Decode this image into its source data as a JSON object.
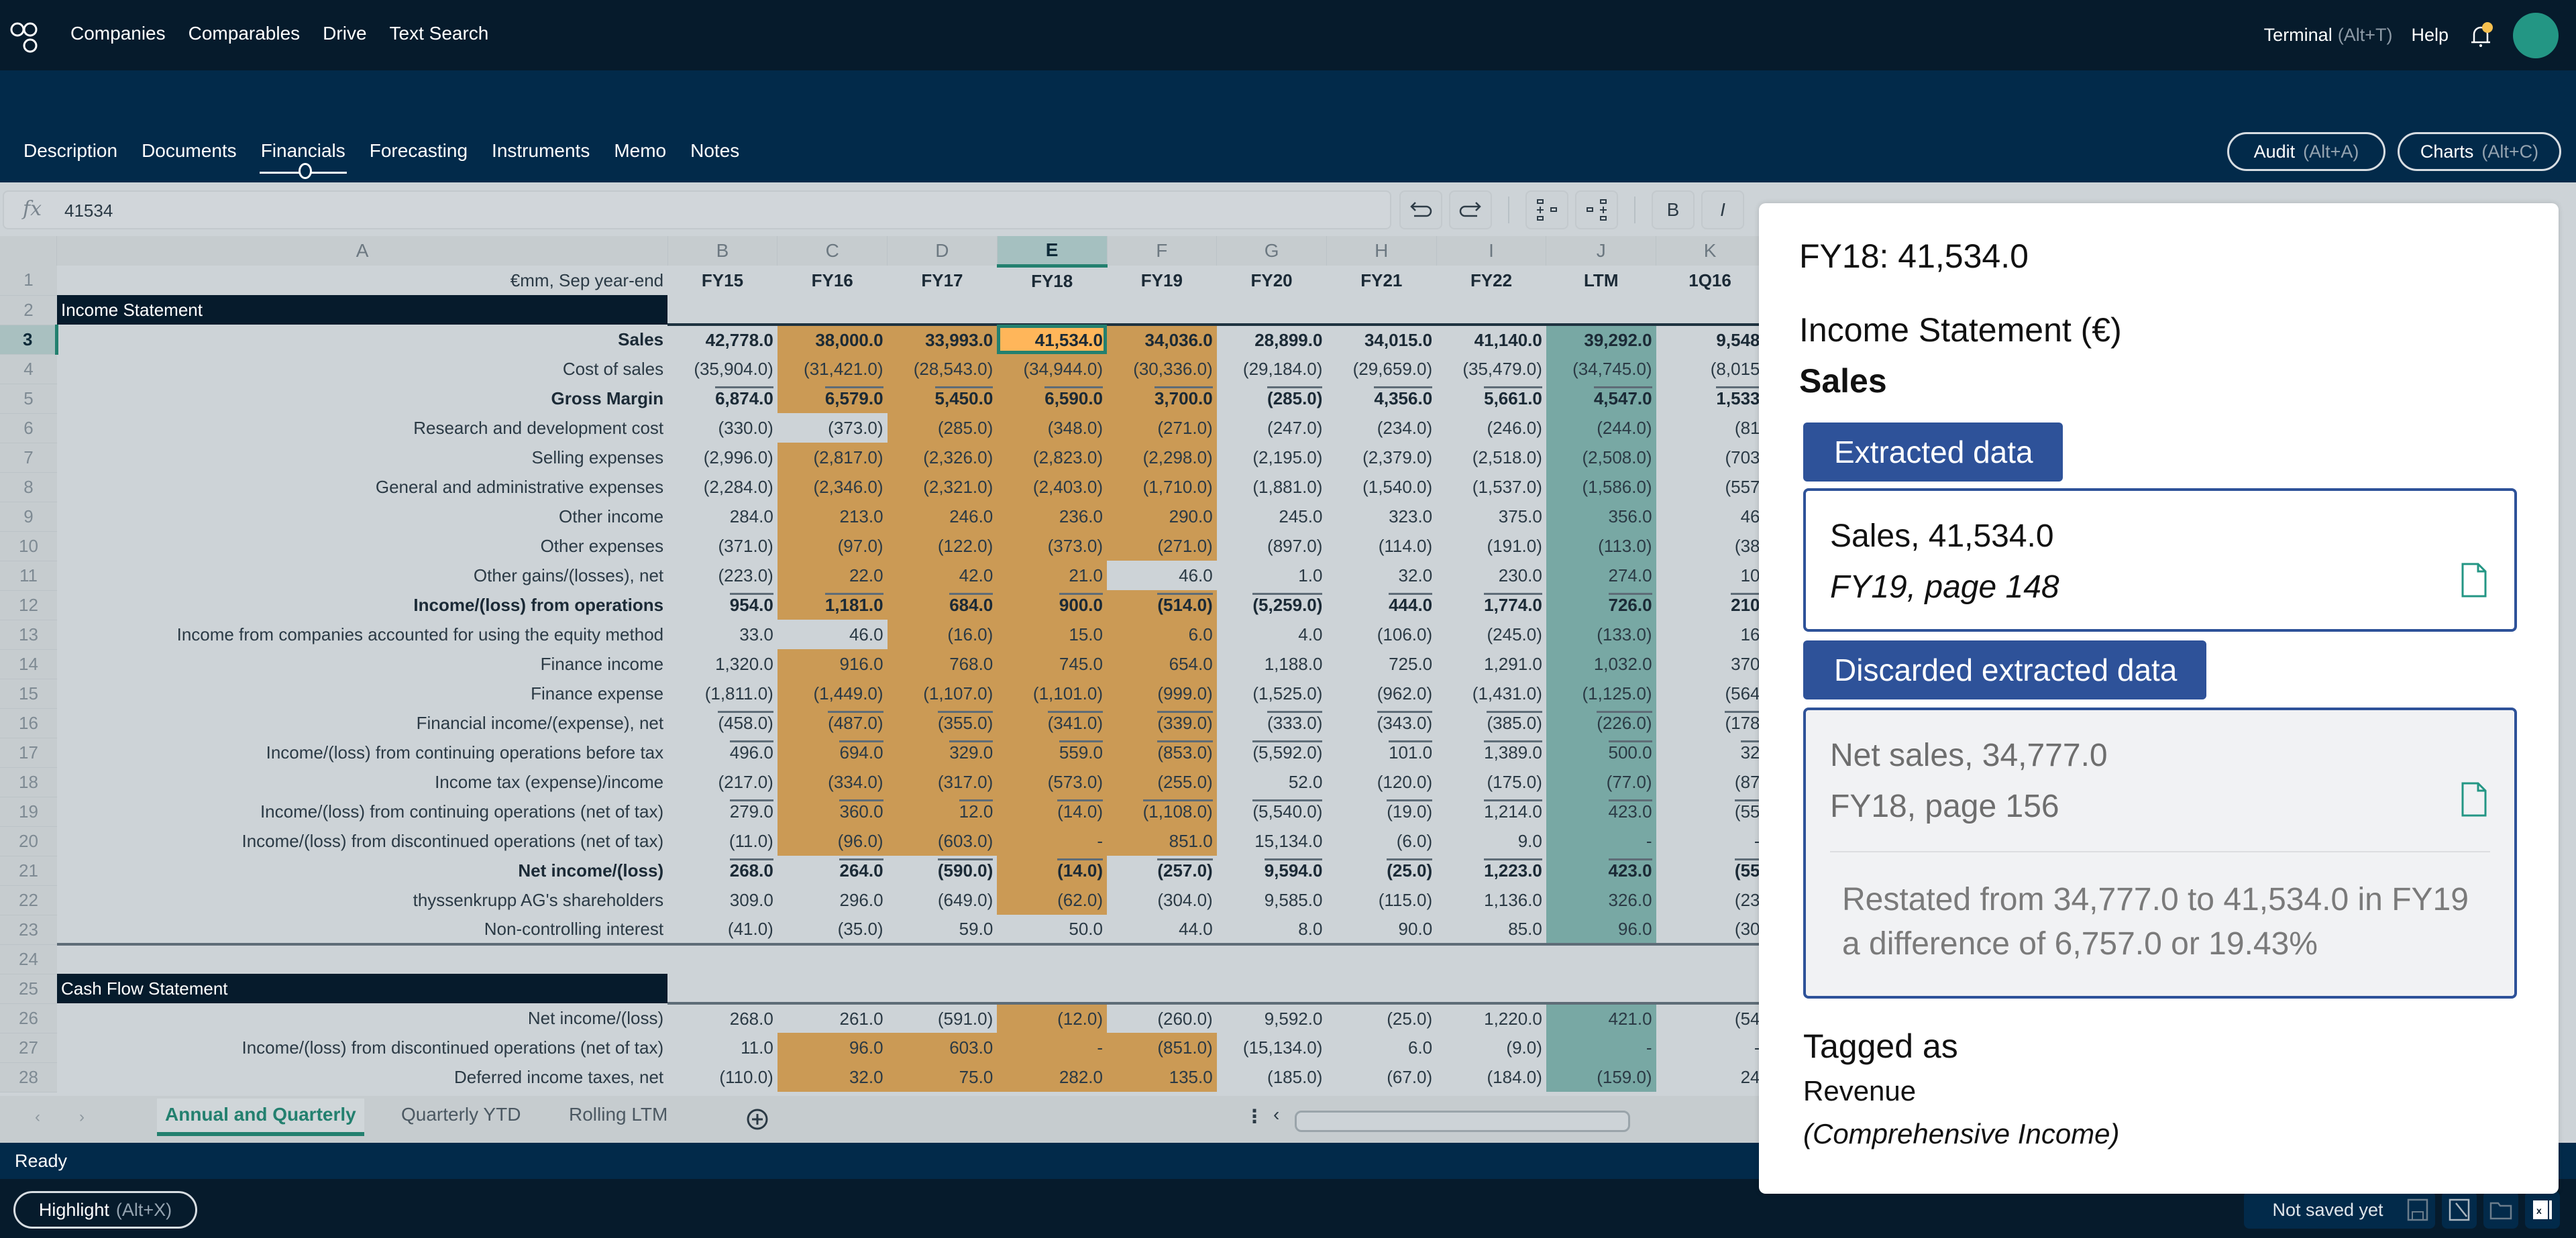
{
  "topbar": {
    "nav": [
      "Companies",
      "Comparables",
      "Drive",
      "Text Search"
    ],
    "terminal_label": "Terminal",
    "terminal_shortcut": "(Alt+T)",
    "help_label": "Help"
  },
  "tabs": [
    "Description",
    "Documents",
    "Financials",
    "Forecasting",
    "Instruments",
    "Memo",
    "Notes"
  ],
  "active_tab": "Financials",
  "actions": {
    "audit_label": "Audit",
    "audit_shortcut": "(Alt+A)",
    "charts_label": "Charts",
    "charts_shortcut": "(Alt+C)"
  },
  "formula_bar": {
    "fx": "fx",
    "value": "41534"
  },
  "toolbar": {
    "bold": "B",
    "italic": "I"
  },
  "sheet": {
    "columns": [
      "A",
      "B",
      "C",
      "D",
      "E",
      "F",
      "G",
      "H",
      "I",
      "J",
      "K"
    ],
    "selected_column": "E",
    "unit_label": "€mm, Sep year-end",
    "periods": [
      "FY15",
      "FY16",
      "FY17",
      "FY18",
      "FY19",
      "FY20",
      "FY21",
      "FY22",
      "LTM",
      "1Q16"
    ],
    "rows": [
      {
        "n": "2",
        "section": "Income Statement"
      },
      {
        "n": "3",
        "label": "Sales",
        "bold": true,
        "values": [
          "42,778.0",
          "38,000.0",
          "33,993.0",
          "41,534.0",
          "34,036.0",
          "28,899.0",
          "34,015.0",
          "41,140.0",
          "39,292.0",
          "9,548"
        ]
      },
      {
        "n": "4",
        "label": "Cost of sales",
        "values": [
          "(35,904.0)",
          "(31,421.0)",
          "(28,543.0)",
          "(34,944.0)",
          "(30,336.0)",
          "(29,184.0)",
          "(29,659.0)",
          "(35,479.0)",
          "(34,745.0)",
          "(8,015"
        ]
      },
      {
        "n": "5",
        "label": "Gross Margin",
        "bold": true,
        "overline": true,
        "values": [
          "6,874.0",
          "6,579.0",
          "5,450.0",
          "6,590.0",
          "3,700.0",
          "(285.0)",
          "4,356.0",
          "5,661.0",
          "4,547.0",
          "1,533"
        ]
      },
      {
        "n": "6",
        "label": "Research and development cost",
        "values": [
          "(330.0)",
          "(373.0)",
          "(285.0)",
          "(348.0)",
          "(271.0)",
          "(247.0)",
          "(234.0)",
          "(246.0)",
          "(244.0)",
          "(81"
        ]
      },
      {
        "n": "7",
        "label": "Selling expenses",
        "values": [
          "(2,996.0)",
          "(2,817.0)",
          "(2,326.0)",
          "(2,823.0)",
          "(2,298.0)",
          "(2,195.0)",
          "(2,379.0)",
          "(2,518.0)",
          "(2,508.0)",
          "(703"
        ]
      },
      {
        "n": "8",
        "label": "General and administrative expenses",
        "values": [
          "(2,284.0)",
          "(2,346.0)",
          "(2,321.0)",
          "(2,403.0)",
          "(1,710.0)",
          "(1,881.0)",
          "(1,540.0)",
          "(1,537.0)",
          "(1,586.0)",
          "(557"
        ]
      },
      {
        "n": "9",
        "label": "Other income",
        "values": [
          "284.0",
          "213.0",
          "246.0",
          "236.0",
          "290.0",
          "245.0",
          "323.0",
          "375.0",
          "356.0",
          "46"
        ]
      },
      {
        "n": "10",
        "label": "Other expenses",
        "values": [
          "(371.0)",
          "(97.0)",
          "(122.0)",
          "(373.0)",
          "(271.0)",
          "(897.0)",
          "(114.0)",
          "(191.0)",
          "(113.0)",
          "(38"
        ]
      },
      {
        "n": "11",
        "label": "Other gains/(losses), net",
        "values": [
          "(223.0)",
          "22.0",
          "42.0",
          "21.0",
          "46.0",
          "1.0",
          "32.0",
          "230.0",
          "274.0",
          "10"
        ]
      },
      {
        "n": "12",
        "label": "Income/(loss) from operations",
        "bold": true,
        "overline": true,
        "values": [
          "954.0",
          "1,181.0",
          "684.0",
          "900.0",
          "(514.0)",
          "(5,259.0)",
          "444.0",
          "1,774.0",
          "726.0",
          "210"
        ]
      },
      {
        "n": "13",
        "label": "Income from companies accounted for using the equity method",
        "values": [
          "33.0",
          "46.0",
          "(16.0)",
          "15.0",
          "6.0",
          "4.0",
          "(106.0)",
          "(245.0)",
          "(133.0)",
          "16"
        ]
      },
      {
        "n": "14",
        "label": "Finance income",
        "values": [
          "1,320.0",
          "916.0",
          "768.0",
          "745.0",
          "654.0",
          "1,188.0",
          "725.0",
          "1,291.0",
          "1,032.0",
          "370"
        ]
      },
      {
        "n": "15",
        "label": "Finance expense",
        "values": [
          "(1,811.0)",
          "(1,449.0)",
          "(1,107.0)",
          "(1,101.0)",
          "(999.0)",
          "(1,525.0)",
          "(962.0)",
          "(1,431.0)",
          "(1,125.0)",
          "(564"
        ]
      },
      {
        "n": "16",
        "label": "Financial income/(expense), net",
        "overline": true,
        "values": [
          "(458.0)",
          "(487.0)",
          "(355.0)",
          "(341.0)",
          "(339.0)",
          "(333.0)",
          "(343.0)",
          "(385.0)",
          "(226.0)",
          "(178"
        ]
      },
      {
        "n": "17",
        "label": "Income/(loss) from continuing operations before tax",
        "overline": true,
        "values": [
          "496.0",
          "694.0",
          "329.0",
          "559.0",
          "(853.0)",
          "(5,592.0)",
          "101.0",
          "1,389.0",
          "500.0",
          "32"
        ]
      },
      {
        "n": "18",
        "label": "Income tax (expense)/income",
        "values": [
          "(217.0)",
          "(334.0)",
          "(317.0)",
          "(573.0)",
          "(255.0)",
          "52.0",
          "(120.0)",
          "(175.0)",
          "(77.0)",
          "(87"
        ]
      },
      {
        "n": "19",
        "label": "Income/(loss) from continuing operations (net of tax)",
        "overline": true,
        "values": [
          "279.0",
          "360.0",
          "12.0",
          "(14.0)",
          "(1,108.0)",
          "(5,540.0)",
          "(19.0)",
          "1,214.0",
          "423.0",
          "(55"
        ]
      },
      {
        "n": "20",
        "label": "Income/(loss) from discontinued operations (net of tax)",
        "values": [
          "(11.0)",
          "(96.0)",
          "(603.0)",
          "-",
          "851.0",
          "15,134.0",
          "(6.0)",
          "9.0",
          "-",
          "-"
        ]
      },
      {
        "n": "21",
        "label": "Net income/(loss)",
        "bold": true,
        "overline": true,
        "values": [
          "268.0",
          "264.0",
          "(590.0)",
          "(14.0)",
          "(257.0)",
          "9,594.0",
          "(25.0)",
          "1,223.0",
          "423.0",
          "(55"
        ]
      },
      {
        "n": "22",
        "label": "thyssenkrupp AG's shareholders",
        "values": [
          "309.0",
          "296.0",
          "(649.0)",
          "(62.0)",
          "(304.0)",
          "9,585.0",
          "(115.0)",
          "1,136.0",
          "326.0",
          "(23"
        ]
      },
      {
        "n": "23",
        "label": "Non-controlling interest",
        "values": [
          "(41.0)",
          "(35.0)",
          "59.0",
          "50.0",
          "44.0",
          "8.0",
          "90.0",
          "85.0",
          "96.0",
          "(30"
        ]
      },
      {
        "n": "24",
        "empty": true
      },
      {
        "n": "25",
        "section": "Cash Flow Statement"
      },
      {
        "n": "26",
        "label": "Net income/(loss)",
        "values": [
          "268.0",
          "261.0",
          "(591.0)",
          "(12.0)",
          "(260.0)",
          "9,592.0",
          "(25.0)",
          "1,220.0",
          "421.0",
          "(54"
        ]
      },
      {
        "n": "27",
        "label": "Income/(loss) from discontinued operations (net of tax)",
        "values": [
          "11.0",
          "96.0",
          "603.0",
          "-",
          "(851.0)",
          "(15,134.0)",
          "6.0",
          "(9.0)",
          "-",
          "-"
        ]
      },
      {
        "n": "28",
        "label": "Deferred income taxes, net",
        "values": [
          "(110.0)",
          "32.0",
          "75.0",
          "282.0",
          "135.0",
          "(185.0)",
          "(67.0)",
          "(184.0)",
          "(159.0)",
          "24"
        ]
      }
    ],
    "sheet_tabs": [
      "Annual and Quarterly",
      "Quarterly YTD",
      "Rolling LTM"
    ],
    "active_sheet_tab": "Annual and Quarterly"
  },
  "status": {
    "text": "Ready",
    "save_state": "Not saved yet"
  },
  "highlight": {
    "label": "Highlight",
    "shortcut": "(Alt+X)"
  },
  "panel": {
    "title": "FY18: 41,534.0",
    "statement": "Income Statement (€)",
    "line_item": "Sales",
    "extracted_badge": "Extracted data",
    "extracted": {
      "line": "Sales, 41,534.0",
      "source": "FY19, page 148"
    },
    "discarded_badge": "Discarded extracted data",
    "discarded": {
      "line": "Net sales, 34,777.0",
      "source": "FY18, page 156",
      "note_line1": "Restated from 34,777.0 to 41,534.0 in FY19",
      "note_line2": "a difference of 6,757.0 or 19.43%"
    },
    "tagged_label": "Tagged as",
    "tag": "Revenue",
    "tag_category": "(Comprehensive Income)"
  },
  "colors": {
    "accent_teal": "#23806f",
    "highlight_orange": "#cb9a55",
    "ltm_teal": "#78a8a4",
    "badge_blue": "#2e5299",
    "navy": "#061b2c"
  }
}
